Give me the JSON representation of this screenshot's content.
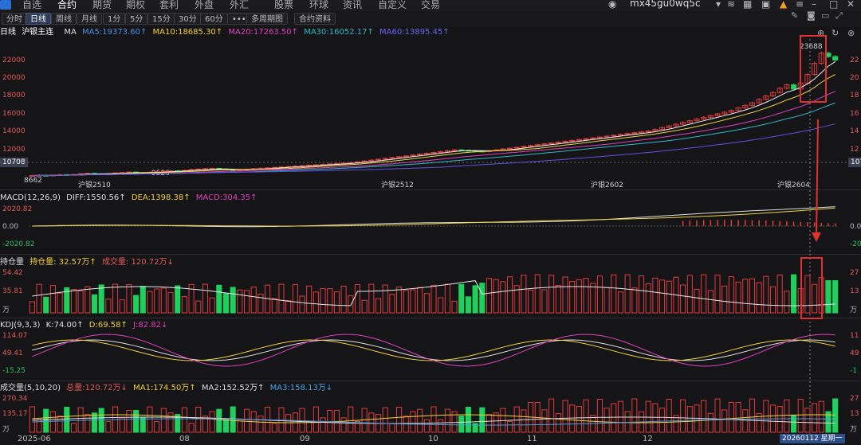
{
  "nav": {
    "items": [
      "自选",
      "合约",
      "期货",
      "期权",
      "套利",
      "外盘",
      "外汇",
      "股票",
      "环球",
      "资讯",
      "自定义",
      "交易"
    ],
    "active_index": 1,
    "user_name": "mx45gu0wq5c"
  },
  "toolbar": {
    "buttons": [
      "分时",
      "日线",
      "周线",
      "月线",
      "1分",
      "5分",
      "15分",
      "30分",
      "60分",
      "•••",
      "多周期图",
      "合约资料"
    ],
    "active_index": 1
  },
  "main_info": {
    "period": "日线",
    "symbol": "沪银主连",
    "ma_label": "MA",
    "ma5": "MA5:19373.60↑",
    "ma10": "MA10:18685.30↑",
    "ma20": "MA20:17263.50↑",
    "ma30": "MA30:16052.17↑",
    "ma60": "MA60:13895.45↑"
  },
  "main_axis": {
    "left_ticks": [
      "22000",
      "20000",
      "18000",
      "16000",
      "14000",
      "12000",
      "10708"
    ],
    "right_ticks": [
      "22",
      "20",
      "18",
      "16",
      "14",
      "12",
      "107"
    ],
    "current_price": "10708"
  },
  "main_annotations": {
    "high": "23688",
    "low": "8662",
    "mid_label": "9526",
    "contracts": [
      "沪银2510",
      "沪银2512",
      "沪银2602",
      "沪银2604"
    ]
  },
  "macd": {
    "title": "MACD(12,26,9)",
    "diff": "DIFF:1550.56↑",
    "dea": "DEA:1398.38↑",
    "macd": "MACD:304.35↑",
    "ticks": [
      "2020.82",
      "0.00",
      "-2020.82"
    ],
    "right_ticks": [
      "",
      "0.0",
      "-20"
    ]
  },
  "oi": {
    "title": "持仓量",
    "oi_value": "持仓量: 32.57万↑",
    "vol_value": "成交量: 120.72万↓",
    "ticks": [
      "54.42",
      "35.81",
      "万"
    ],
    "right_ticks": [
      "27",
      "13",
      "万"
    ]
  },
  "kdj": {
    "title": "KDJ(9,3,3)",
    "k": "K:74.00↑",
    "d": "D:69.58↑",
    "j": "J:82.82↓",
    "ticks": [
      "114.07",
      "49.41",
      "-15.25"
    ],
    "right_ticks": [
      "11",
      "49",
      "-1"
    ]
  },
  "volume": {
    "title": "成交量(5,10,20)",
    "total": "总量:120.72万↓",
    "ma1": "MA1:174.50万↑",
    "ma2": "MA2:152.52万↑",
    "ma3": "MA3:158.13万↓",
    "ticks": [
      "270.34",
      "135.17",
      "万"
    ],
    "right_ticks": [
      "27",
      "13",
      "万"
    ]
  },
  "time_axis": {
    "months": [
      "2025-06",
      "08",
      "09",
      "10",
      "11",
      "12"
    ],
    "cursor_date": "20260112 星期一"
  },
  "colors": {
    "up": "#e03b3b",
    "down": "#1fd15c",
    "ma5": "#f0f0f0",
    "ma10": "#f0d040",
    "ma20": "#e040c0",
    "ma30": "#30b8c8",
    "ma60": "#6050e0",
    "highlight": "#e03030"
  },
  "chart_data": {
    "type": "candlestick",
    "instrument": "沪银主连",
    "period": "日线",
    "x_start": "2025-06",
    "x_end": "2026-01-12",
    "close_series": [
      8700,
      8720,
      8690,
      8750,
      8800,
      8780,
      8820,
      8900,
      8950,
      8900,
      8880,
      8930,
      9000,
      9050,
      9100,
      9020,
      9000,
      9080,
      9150,
      9200,
      9250,
      9200,
      9300,
      9400,
      9450,
      9500,
      9526,
      9450,
      9400,
      9350,
      9380,
      9420,
      9500,
      9550,
      9600,
      9650,
      9700,
      9750,
      9800,
      9850,
      9900,
      9950,
      10000,
      10050,
      10100,
      10150,
      10200,
      10300,
      10400,
      10500,
      10600,
      10700,
      10800,
      10900,
      11000,
      11100,
      11200,
      11300,
      11400,
      11500,
      11600,
      11700,
      11650,
      11600,
      11550,
      11500,
      11600,
      11700,
      11800,
      11900,
      12000,
      12100,
      12200,
      12300,
      12400,
      12500,
      12600,
      12700,
      12800,
      12900,
      13000,
      13100,
      13200,
      13300,
      13400,
      13500,
      13600,
      13700,
      13800,
      13900,
      14100,
      14300,
      14500,
      14700,
      14900,
      15100,
      15300,
      15500,
      15700,
      15900,
      16100,
      16300,
      16600,
      16900,
      17200,
      17600,
      18000,
      18400,
      18900,
      19300,
      18800,
      19500,
      20500,
      21800,
      23000,
      22600,
      22200
    ],
    "ylim": [
      8000,
      24000
    ],
    "high_marker": 23688,
    "low_marker": 8662
  }
}
